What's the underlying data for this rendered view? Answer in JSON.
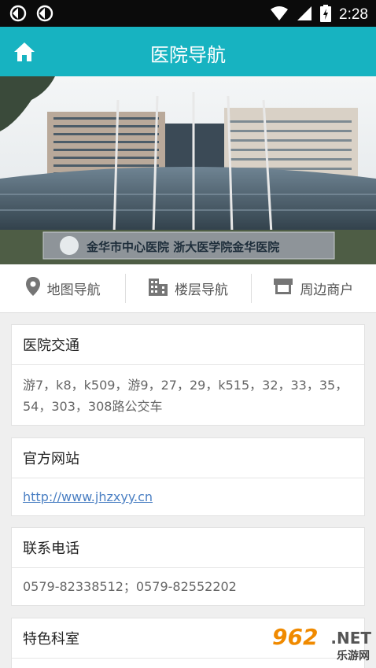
{
  "status_bar": {
    "time": "2:28",
    "icons": [
      "sync-icon",
      "sync-icon",
      "wifi-icon",
      "signal-icon",
      "battery-charging-icon"
    ]
  },
  "app_bar": {
    "title": "医院导航",
    "home_icon": "home-icon"
  },
  "hero": {
    "sign_text": "金华市中心医院 浙大医学院金华医院"
  },
  "nav": [
    {
      "label": "地图导航",
      "icon": "location-pin-icon"
    },
    {
      "label": "楼层导航",
      "icon": "building-icon"
    },
    {
      "label": "周边商户",
      "icon": "storefront-icon"
    }
  ],
  "cards": {
    "traffic": {
      "title": "医院交通",
      "body": "游7，k8，k509，游9，27，29，k515，32，33，35，54，303，308路公交车"
    },
    "website": {
      "title": "官方网站",
      "link": "http://www.jhzxyy.cn"
    },
    "phone": {
      "title": "联系电话",
      "body": "0579-82338512；0579-82552202"
    },
    "dept": {
      "title": "特色科室"
    }
  },
  "watermark": {
    "num": "962",
    "net": ".NET",
    "sub": "乐游网"
  },
  "colors": {
    "accent": "#17b3c1",
    "link": "#4a7fc3",
    "status_bar": "#0b0b0b"
  }
}
